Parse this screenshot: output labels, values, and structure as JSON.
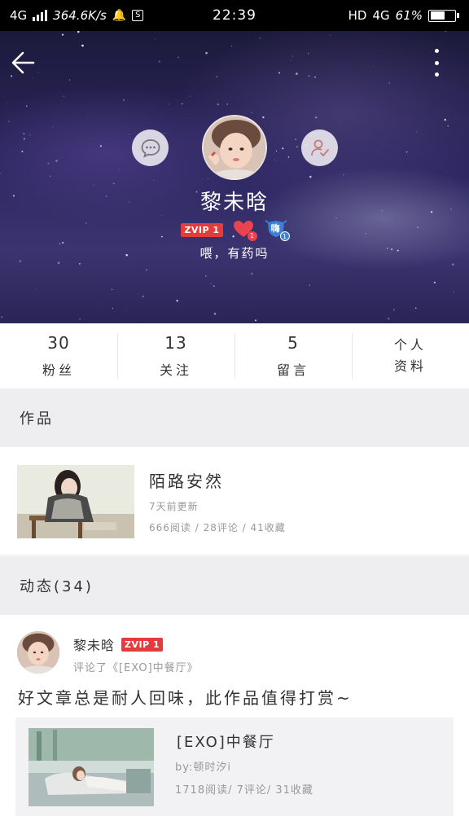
{
  "status_bar": {
    "network": "4G",
    "speed": "364.6K/s",
    "time": "22:39",
    "hd": "HD",
    "network_right": "4G",
    "battery": "61%",
    "battery_level": 0.61
  },
  "profile": {
    "username": "黎未晗",
    "vip_badge": "ZVIP 1",
    "heart_badge_level": "1",
    "fan_badge_level": "1",
    "fan_badge_char": "嗨",
    "signature": "喂，有药吗"
  },
  "stats": [
    {
      "value": "30",
      "label": "粉丝"
    },
    {
      "value": "13",
      "label": "关注"
    },
    {
      "value": "5",
      "label": "留言"
    }
  ],
  "profile_info": {
    "label_line1": "个人",
    "label_line2": "资料"
  },
  "works_section": {
    "title": "作品",
    "items": [
      {
        "title": "陌路安然",
        "updated": "7天前更新",
        "stats": "666阅读 / 28评论 / 41收藏"
      }
    ]
  },
  "feed_section": {
    "title": "动态(34)",
    "items": [
      {
        "user": "黎未晗",
        "vip_badge": "ZVIP 1",
        "action": "评论了《[EXO]中餐厅》",
        "text": "好文章总是耐人回味，此作品值得打赏~",
        "quoted": {
          "title": "[EXO]中餐厅",
          "author": "by:顿时汐i",
          "stats": "1718阅读/ 7评论/ 31收藏"
        }
      }
    ]
  },
  "icons": {
    "back": "arrow-left-icon",
    "more": "more-vertical-icon",
    "chat": "chat-bubble-icon",
    "follow": "user-check-icon"
  }
}
